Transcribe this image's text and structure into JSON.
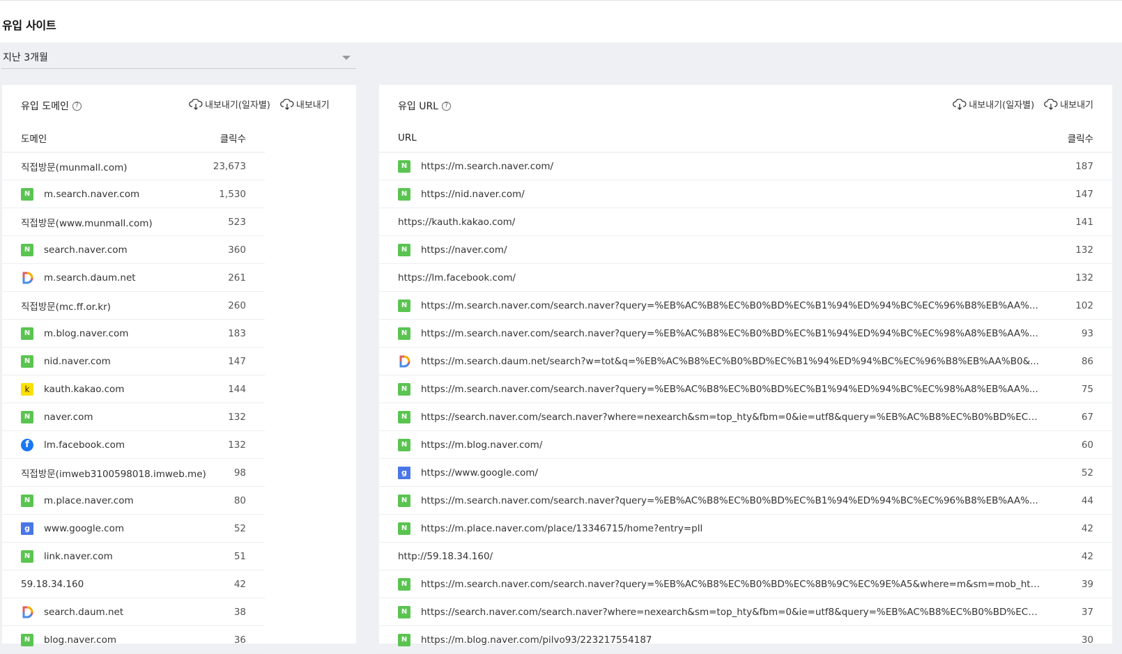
{
  "page": {
    "title": "유입 사이트"
  },
  "period": {
    "selected": "지난 3개월"
  },
  "export": {
    "daily_label": "내보내기(일자별)",
    "label": "내보내기"
  },
  "domains": {
    "title": "유입 도메인",
    "col_domain": "도메인",
    "col_clicks": "클릭수",
    "rows": [
      {
        "name": "직접방문(munmall.com)",
        "clicks": "23,673",
        "icon": ""
      },
      {
        "name": "m.search.naver.com",
        "clicks": "1,530",
        "icon": "naver-icon"
      },
      {
        "name": "직접방문(www.munmall.com)",
        "clicks": "523",
        "icon": ""
      },
      {
        "name": "search.naver.com",
        "clicks": "360",
        "icon": "naver-icon"
      },
      {
        "name": "m.search.daum.net",
        "clicks": "261",
        "icon": "daum-icon"
      },
      {
        "name": "직접방문(mc.ff.or.kr)",
        "clicks": "260",
        "icon": ""
      },
      {
        "name": "m.blog.naver.com",
        "clicks": "183",
        "icon": "naver-icon"
      },
      {
        "name": "nid.naver.com",
        "clicks": "147",
        "icon": "naver-icon"
      },
      {
        "name": "kauth.kakao.com",
        "clicks": "144",
        "icon": "kakao-icon"
      },
      {
        "name": "naver.com",
        "clicks": "132",
        "icon": "naver-icon"
      },
      {
        "name": "lm.facebook.com",
        "clicks": "132",
        "icon": "facebook-icon"
      },
      {
        "name": "직접방문(imweb3100598018.imweb.me)",
        "clicks": "98",
        "icon": ""
      },
      {
        "name": "m.place.naver.com",
        "clicks": "80",
        "icon": "naver-icon"
      },
      {
        "name": "www.google.com",
        "clicks": "52",
        "icon": "google-icon"
      },
      {
        "name": "link.naver.com",
        "clicks": "51",
        "icon": "naver-icon"
      },
      {
        "name": "59.18.34.160",
        "clicks": "42",
        "icon": ""
      },
      {
        "name": "search.daum.net",
        "clicks": "38",
        "icon": "daum-icon"
      },
      {
        "name": "blog.naver.com",
        "clicks": "36",
        "icon": "naver-icon"
      }
    ]
  },
  "urls": {
    "title": "유입 URL",
    "col_url": "URL",
    "col_clicks": "클릭수",
    "rows": [
      {
        "url": "https://m.search.naver.com/",
        "clicks": "187",
        "icon": "naver-icon"
      },
      {
        "url": "https://nid.naver.com/",
        "clicks": "147",
        "icon": "naver-icon"
      },
      {
        "url": "https://kauth.kakao.com/",
        "clicks": "141",
        "icon": ""
      },
      {
        "url": "https://naver.com/",
        "clicks": "132",
        "icon": "naver-icon"
      },
      {
        "url": "https://lm.facebook.com/",
        "clicks": "132",
        "icon": ""
      },
      {
        "url": "https://m.search.naver.com/search.naver?query=%EB%AC%B8%EC%B0%BD%EC%B1%94%ED%94%BC%EC%96%B8%EB%AA%...",
        "clicks": "102",
        "icon": "naver-icon"
      },
      {
        "url": "https://m.search.naver.com/search.naver?query=%EB%AC%B8%EC%B0%BD%EC%B1%94%ED%94%BC%EC%98%A8%EB%AA%...",
        "clicks": "93",
        "icon": "naver-icon"
      },
      {
        "url": "https://m.search.daum.net/search?w=tot&q=%EB%AC%B8%EC%B0%BD%EC%B1%94%ED%94%BC%EC%96%B8%EB%AA%B0&...",
        "clicks": "86",
        "icon": "daum-icon"
      },
      {
        "url": "https://m.search.naver.com/search.naver?query=%EB%AC%B8%EC%B0%BD%EC%B1%94%ED%94%BC%EC%98%A8%EB%AA%...",
        "clicks": "75",
        "icon": "naver-icon"
      },
      {
        "url": "https://search.naver.com/search.naver?where=nexearch&sm=top_hty&fbm=0&ie=utf8&query=%EB%AC%B8%EC%B0%BD%EC%B...",
        "clicks": "67",
        "icon": "naver-icon"
      },
      {
        "url": "https://m.blog.naver.com/",
        "clicks": "60",
        "icon": "naver-icon"
      },
      {
        "url": "https://www.google.com/",
        "clicks": "52",
        "icon": "google-icon"
      },
      {
        "url": "https://m.search.naver.com/search.naver?query=%EB%AC%B8%EC%B0%BD%EC%B1%94%ED%94%BC%EC%96%B8%EB%AA%...",
        "clicks": "44",
        "icon": "naver-icon"
      },
      {
        "url": "https://m.place.naver.com/place/13346715/home?entry=pll",
        "clicks": "42",
        "icon": "naver-icon"
      },
      {
        "url": "http://59.18.34.160/",
        "clicks": "42",
        "icon": ""
      },
      {
        "url": "https://m.search.naver.com/search.naver?query=%EB%AC%B8%EC%B0%BD%EC%8B%9C%EC%9E%A5&where=m&sm=mob_hty...",
        "clicks": "39",
        "icon": "naver-icon"
      },
      {
        "url": "https://search.naver.com/search.naver?where=nexearch&sm=top_hty&fbm=0&ie=utf8&query=%EB%AC%B8%EC%B0%BD%EC%8...",
        "clicks": "37",
        "icon": "naver-icon"
      },
      {
        "url": "https://m.blog.naver.com/pilvo93/223217554187",
        "clicks": "30",
        "icon": "naver-icon"
      }
    ]
  },
  "colors": {
    "naver": "#5ac451",
    "kakao": "#f9e000",
    "facebook": "#1877f2",
    "google": "#4a76e8",
    "background": "#eef0f4"
  }
}
